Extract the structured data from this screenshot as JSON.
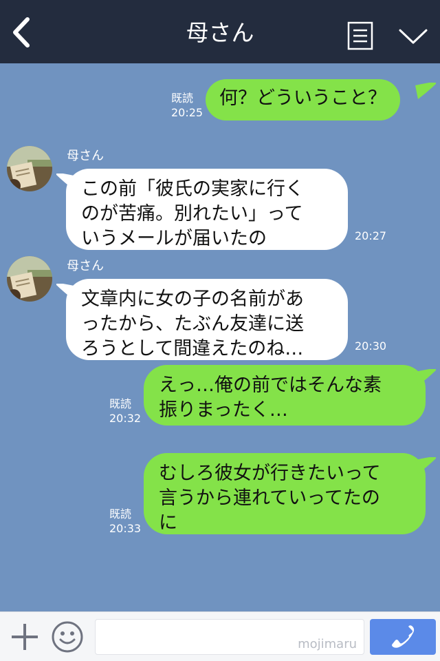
{
  "header": {
    "title": "母さん",
    "back_icon": "chevron-left-icon",
    "menu_icon": "note-icon",
    "collapse_icon": "chevron-down-icon"
  },
  "messages": [
    {
      "side": "right",
      "lines": [
        "何？どういうこと？"
      ],
      "read": "既読",
      "time": "20:25"
    },
    {
      "side": "left",
      "sender": "母さん",
      "lines": [
        "この前「彼氏の実家に行く",
        "のが苦痛。別れたい」って",
        "いうメールが届いたの"
      ],
      "time": "20:27"
    },
    {
      "side": "left",
      "sender": "母さん",
      "lines": [
        "文章内に女の子の名前があ",
        "ったから、たぶん友達に送",
        "ろうとして間違えたのね…"
      ],
      "time": "20:30"
    },
    {
      "side": "right",
      "lines": [
        "えっ…俺の前ではそんな素",
        "振りまったく…"
      ],
      "read": "既読",
      "time": "20:32"
    },
    {
      "side": "right",
      "lines": [
        "むしろ彼女が行きたいって",
        "言うから連れていってたの",
        "に"
      ],
      "read": "既読",
      "time": "20:33"
    }
  ],
  "footer": {
    "plus_icon": "plus-icon",
    "emoji_icon": "smiley-icon",
    "input_value": "",
    "watermark": "mojimaru",
    "call_icon": "phone-icon"
  },
  "colors": {
    "header": "#232c3e",
    "background": "#7093c0",
    "sent": "#84e249",
    "received": "#ffffff",
    "call_button": "#5b8ae8"
  }
}
